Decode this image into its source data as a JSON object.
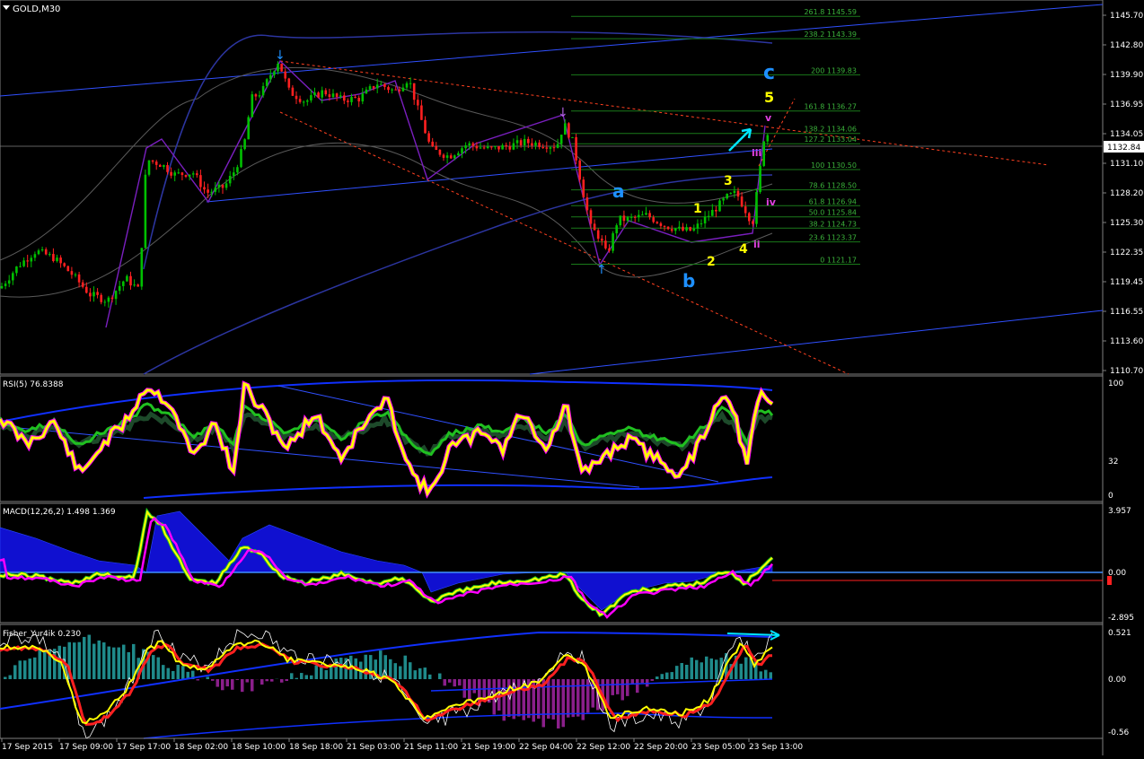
{
  "title": "GOLD,M30",
  "colors": {
    "bg": "#000000",
    "grid": "#3a3a3a",
    "text": "#ffffff",
    "bull": "#00c000",
    "bear": "#ff2020",
    "wave_cyan": "#1e90ff",
    "wave_yellow": "#ffff00",
    "wave_magenta": "#e040e0",
    "fib": "#1a7a1a",
    "channel_blue": "#3050ff",
    "dashed_red": "#ff4020",
    "accent_cyan": "#00e5ff"
  },
  "main_chart": {
    "price_ticks": [
      "1145.70",
      "1142.80",
      "1139.90",
      "1136.95",
      "1134.05",
      "1131.10",
      "1128.20",
      "1125.30",
      "1122.35",
      "1119.45",
      "1116.55",
      "1113.60",
      "1110.70"
    ],
    "current_price": "1132.84",
    "fib_levels": [
      {
        "label": "261.8 1145.59",
        "value": 1145.59
      },
      {
        "label": "238.2 1143.39",
        "value": 1143.39
      },
      {
        "label": "200 1139.83",
        "value": 1139.83
      },
      {
        "label": "161.8 1136.27",
        "value": 1136.27
      },
      {
        "label": "138.2 1134.06",
        "value": 1134.06
      },
      {
        "label": "127.2 1133.04",
        "value": 1133.04
      },
      {
        "label": "100 1130.50",
        "value": 1130.5
      },
      {
        "label": "78.6 1128.50",
        "value": 1128.5
      },
      {
        "label": "61.8 1126.94",
        "value": 1126.94
      },
      {
        "label": "50.0 1125.84",
        "value": 1125.84
      },
      {
        "label": "38.2 1124.73",
        "value": 1124.73
      },
      {
        "label": "23.6 1123.37",
        "value": 1123.37
      },
      {
        "label": "0 1121.17",
        "value": 1121.17
      }
    ],
    "wave_labels": {
      "c": "c",
      "a": "a",
      "b": "b",
      "w1": "1",
      "w2": "2",
      "w3": "3",
      "w4": "4",
      "w5": "5",
      "ii": "ii",
      "iii": "iii",
      "iv": "iv",
      "v": "v"
    }
  },
  "rsi": {
    "label": "RSI(5) 76.8388",
    "ticks": [
      "100",
      "32",
      "0"
    ]
  },
  "macd": {
    "label": "MACD(12,26,2) 1.498 1.369",
    "ticks": [
      "3.957",
      "0.00",
      "-2.895"
    ]
  },
  "fisher": {
    "label": "Fisher_Yur4ik 0.230",
    "ticks": [
      "0.521",
      "0.00",
      "-0.56"
    ]
  },
  "time_axis": [
    "17 Sep 2015",
    "17 Sep 09:00",
    "17 Sep 17:00",
    "18 Sep 02:00",
    "18 Sep 10:00",
    "18 Sep 18:00",
    "21 Sep 03:00",
    "21 Sep 11:00",
    "21 Sep 19:00",
    "22 Sep 04:00",
    "22 Sep 12:00",
    "22 Sep 20:00",
    "23 Sep 05:00",
    "23 Sep 13:00"
  ],
  "path_key": [
    [
      0,
      1118.8
    ],
    [
      20,
      1121.0
    ],
    [
      40,
      1122.5
    ],
    [
      60,
      1121.8
    ],
    [
      80,
      1120.2
    ],
    [
      100,
      1118.2
    ],
    [
      120,
      1117.6
    ],
    [
      140,
      1119.8
    ],
    [
      155,
      1118.6
    ],
    [
      163,
      1131.5
    ],
    [
      180,
      1131.0
    ],
    [
      195,
      1130.0
    ],
    [
      215,
      1130.2
    ],
    [
      230,
      1128.2
    ],
    [
      250,
      1128.8
    ],
    [
      262,
      1130.5
    ],
    [
      272,
      1133.0
    ],
    [
      280,
      1137.5
    ],
    [
      292,
      1138.2
    ],
    [
      302,
      1140.0
    ],
    [
      310,
      1141.2
    ],
    [
      322,
      1138.2
    ],
    [
      340,
      1137.2
    ],
    [
      360,
      1138.2
    ],
    [
      380,
      1137.4
    ],
    [
      400,
      1137.5
    ],
    [
      420,
      1139.0
    ],
    [
      440,
      1138.2
    ],
    [
      455,
      1139.5
    ],
    [
      465,
      1136.5
    ],
    [
      480,
      1132.5
    ],
    [
      500,
      1131.8
    ],
    [
      520,
      1133.0
    ],
    [
      545,
      1132.5
    ],
    [
      565,
      1132.8
    ],
    [
      585,
      1133.2
    ],
    [
      605,
      1133.0
    ],
    [
      620,
      1132.8
    ],
    [
      628,
      1135.0
    ],
    [
      638,
      1133.2
    ],
    [
      648,
      1128.8
    ],
    [
      658,
      1124.8
    ],
    [
      668,
      1123.8
    ],
    [
      676,
      1122.0
    ],
    [
      688,
      1125.6
    ],
    [
      700,
      1125.6
    ],
    [
      720,
      1126.0
    ],
    [
      740,
      1125.0
    ],
    [
      760,
      1124.5
    ],
    [
      772,
      1124.5
    ],
    [
      782,
      1125.4
    ],
    [
      795,
      1126.5
    ],
    [
      810,
      1127.8
    ],
    [
      820,
      1128.2
    ],
    [
      832,
      1126.2
    ],
    [
      838,
      1125.2
    ],
    [
      845,
      1129.5
    ],
    [
      852,
      1134.5
    ],
    [
      860,
      1133.0
    ]
  ]
}
